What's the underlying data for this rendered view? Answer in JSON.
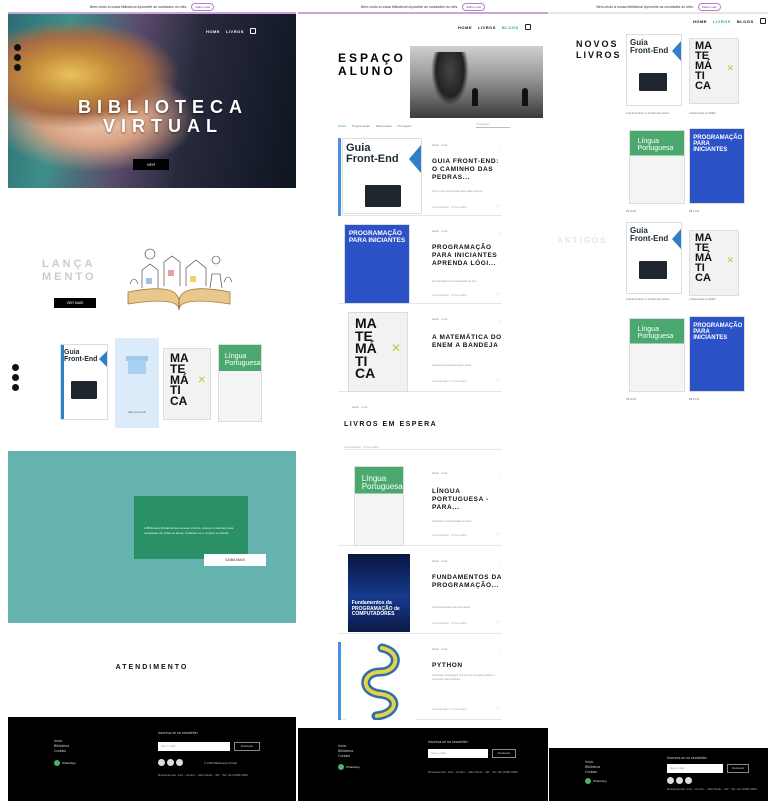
{
  "promo": {
    "text": "Bem-vindo à nossa biblioteca! Aproveite as novidades do mês.",
    "button": "Saiba mais",
    "accent_color": "#b77fcf"
  },
  "nav": {
    "items": [
      "HOME",
      "LIVROS",
      "BLOGS"
    ],
    "active_item": "BLOGS",
    "active_color": "#2ea28c",
    "cart_icon": "cart-icon"
  },
  "page_a": {
    "social_icons": [
      "facebook-icon",
      "instagram-icon",
      "twitter-icon"
    ],
    "hero": {
      "title_line1": "BIBLIOTECA",
      "title_line2": "VIRTUAL",
      "button": "VER"
    },
    "lancamento": {
      "title_line1": "LANÇA",
      "title_line2": "MENTO",
      "button": "VER MAIS"
    },
    "gift_label": "Vale presente",
    "about": {
      "text": "A Biblioteca Virtual oferece acesso a livros, cursos e materiais para estudantes de todas as áreas. Cadastre-se e comece a estudar.",
      "button": "SAIBA MAIS",
      "bg_color": "#65b3ae",
      "box_color": "#2a9066"
    },
    "atendimento": "ATENDIMENTO"
  },
  "page_b": {
    "title_line1": "ESPAÇO",
    "title_line2": "ALUNO",
    "filters": [
      "Todos",
      "Programação",
      "Matemática",
      "Português"
    ],
    "active_filter": "Todos",
    "search_placeholder": "Pesquisar",
    "posts_meta": "Admin · 2 min",
    "posts_stats": "0 visualizações · 0 comentários",
    "posts": [
      {
        "title": "GUIA FRONT-END: O CAMINHO DAS PEDRAS...",
        "excerpt": "Tudo o que você precisa saber para começar."
      },
      {
        "title": "PROGRAMAÇÃO PARA INICIANTES APRENDA LÓGI...",
        "excerpt": "Aprenda lógica de programação do zero."
      },
      {
        "title": "A MATEMÁTICA DO ENEM A BANDEJA",
        "excerpt": "Conteúdos essenciais para a prova."
      }
    ],
    "espera_title": "LIVROS EM ESPERA",
    "espera_posts": [
      {
        "title": "LÍNGUA PORTUGUESA - PARA...",
        "excerpt": "Gramática e interpretação de textos."
      },
      {
        "title": "FUNDAMENTOS DA PROGRAMAÇÃO...",
        "excerpt": "Conceitos básicos de computação."
      },
      {
        "title": "PYTHON",
        "excerpt": "Introdução à linguagem Python com exemplos práticos e exercícios para iniciantes."
      }
    ]
  },
  "page_c": {
    "title_line1": "NOVOS",
    "title_line2": "LIVROS",
    "antigos": "ANTIGOS",
    "captions": [
      "Guia Front-End: o caminho das pedras",
      "A Matemática do ENEM",
      "Língua Portuguesa",
      "Programação para Iniciantes"
    ],
    "prices": [
      "R$ 49,90",
      "R$ 39,90",
      "R$ 29,90",
      "R$ 44,90"
    ]
  },
  "covers": {
    "guia_line1": "Guia",
    "guia_line2": "Front-End",
    "mat_lines": [
      "MA",
      "TE",
      "MÁ",
      "TI",
      "CA"
    ],
    "mat_x": "✕",
    "lp_line1": "Língua",
    "lp_line2": "Portuguesa",
    "prog": "PROGRAMAÇÃO PARA INICIANTES",
    "fund": "Fundamentos da PROGRAMAÇÃO de COMPUTADORES"
  },
  "footer": {
    "links": [
      "Início",
      "Biblioteca",
      "Contato"
    ],
    "whatsapp": "WhatsApp",
    "newsletter_title": "Inscreva-se na newsletter",
    "email_placeholder": "Seu e-mail",
    "subscribe": "Inscrever",
    "copyright": "© 2023 Biblioteca Virtual",
    "address": "Rua Exemplo, 123 – Centro – São Paulo – SP · Tel: (11) 0000-0000"
  }
}
